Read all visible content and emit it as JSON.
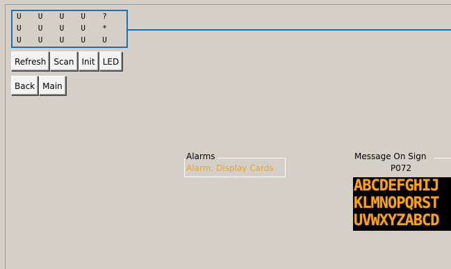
{
  "status_grid": {
    "rows": [
      [
        "U",
        "U",
        "U",
        "U",
        "?"
      ],
      [
        "U",
        "U",
        "U",
        "U",
        "*"
      ],
      [
        "U",
        "U",
        "U",
        "U",
        "U"
      ]
    ]
  },
  "buttons": {
    "refresh": "Refresh",
    "scan": "Scan",
    "init": "Init",
    "led": "LED",
    "back": "Back",
    "main": "Main"
  },
  "alarms": {
    "title": "Alarms",
    "message": "Alarm: Display Cards"
  },
  "sign": {
    "title": "Message On Sign",
    "id": "P072",
    "lines": [
      "ABCDEFGHIJ",
      "KLMNOPQRST",
      "UVWXYZABCD"
    ]
  },
  "colors": {
    "accent_blue": "#1f6fb0",
    "alarm_orange": "#f4a11e",
    "led_background": "#000000",
    "window_background": "#d4d0c8"
  }
}
